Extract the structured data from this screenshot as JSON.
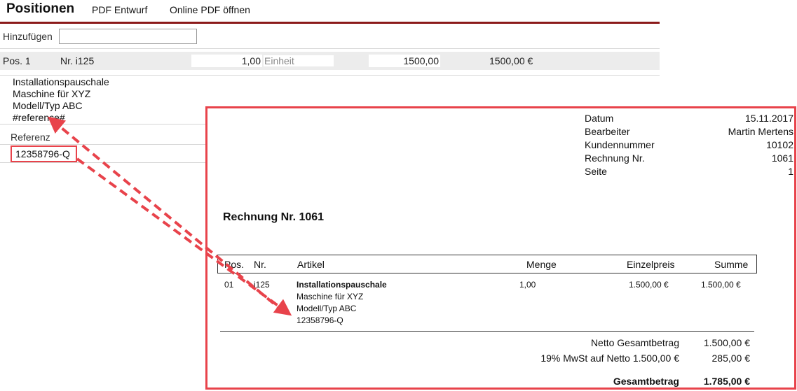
{
  "header": {
    "title": "Positionen",
    "pdf_draft": "PDF Entwurf",
    "open_online_pdf": "Online PDF öffnen"
  },
  "add": {
    "label": "Hinzufügen",
    "value": ""
  },
  "position": {
    "pos": "Pos. 1",
    "nr": "Nr. i125",
    "quantity": "1,00",
    "unit": "Einheit",
    "unit_price": "1500,00",
    "total": "1500,00 €"
  },
  "description_lines": [
    "Installationspauschale",
    "Maschine für XYZ",
    "Modell/Typ ABC",
    "#reference#"
  ],
  "reference": {
    "label": "Referenz",
    "value": "12358796-Q"
  },
  "pdf": {
    "meta": [
      {
        "label": "Datum",
        "value": "15.11.2017"
      },
      {
        "label": "Bearbeiter",
        "value": "Martin Mertens"
      },
      {
        "label": "Kundennummer",
        "value": "10102"
      },
      {
        "label": "Rechnung Nr.",
        "value": "1061"
      },
      {
        "label": "Seite",
        "value": "1"
      }
    ],
    "title": "Rechnung Nr. 1061",
    "columns": {
      "pos": "Pos.",
      "nr": "Nr.",
      "article": "Artikel",
      "qty": "Menge",
      "unit_price": "Einzelpreis",
      "sum": "Summe"
    },
    "item": {
      "pos": "01",
      "nr": "i125",
      "name": "Installationspauschale",
      "line2": "Maschine für XYZ",
      "line3": "Modell/Typ ABC",
      "line4": "12358796-Q",
      "qty": "1,00",
      "unit_price": "1.500,00 €",
      "sum": "1.500,00 €"
    },
    "totals": {
      "net_label": "Netto Gesamtbetrag",
      "net_value": "1.500,00 €",
      "vat_label": "19% MwSt auf Netto 1.500,00 €",
      "vat_value": "285,00 €",
      "gross_label": "Gesamtbetrag",
      "gross_value": "1.785,00 €"
    }
  },
  "colors": {
    "accent": "#8b1a1a",
    "highlight": "#e8434b",
    "row_bg": "#ececec"
  }
}
